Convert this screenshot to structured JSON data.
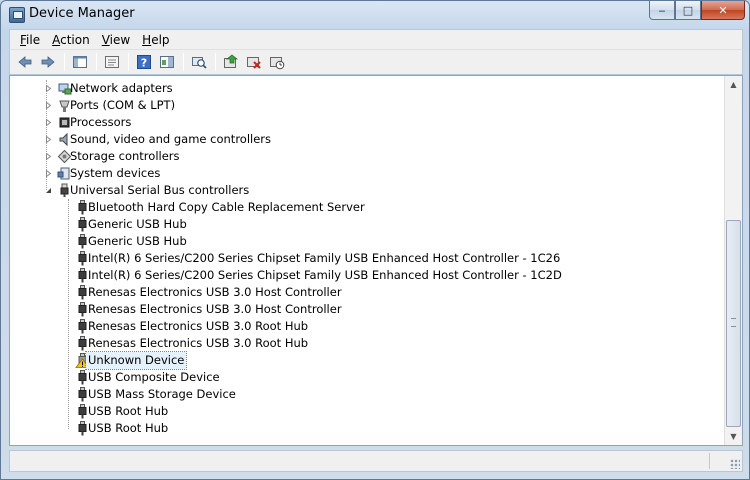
{
  "window": {
    "title": "Device Manager",
    "icon": "device-manager-icon",
    "caption_buttons": {
      "minimize": "‒",
      "maximize": "□",
      "close": "✕"
    }
  },
  "menu": {
    "items": [
      {
        "label": "File",
        "accel": "F",
        "rest": "ile"
      },
      {
        "label": "Action",
        "accel": "A",
        "rest": "ction"
      },
      {
        "label": "View",
        "accel": "V",
        "rest": "iew"
      },
      {
        "label": "Help",
        "accel": "H",
        "rest": "elp"
      }
    ]
  },
  "toolbar": {
    "buttons": [
      "back-icon",
      "forward-icon",
      "show-hide-console-tree-icon",
      "properties-icon",
      "help-icon",
      "action-pane-icon",
      "scan-hardware-icon",
      "update-driver-icon",
      "uninstall-icon",
      "disable-icon"
    ]
  },
  "tree": {
    "categories": [
      {
        "label": "Network adapters",
        "icon": "network-adapter-icon",
        "expanded": false
      },
      {
        "label": "Ports (COM & LPT)",
        "icon": "port-icon",
        "expanded": false
      },
      {
        "label": "Processors",
        "icon": "processor-icon",
        "expanded": false
      },
      {
        "label": "Sound, video and game controllers",
        "icon": "speaker-icon",
        "expanded": false
      },
      {
        "label": "Storage controllers",
        "icon": "storage-controller-icon",
        "expanded": false
      },
      {
        "label": "System devices",
        "icon": "system-device-icon",
        "expanded": false
      },
      {
        "label": "Universal Serial Bus controllers",
        "icon": "usb-icon",
        "expanded": true
      }
    ],
    "usb_children": [
      {
        "label": "Bluetooth Hard Copy Cable Replacement Server",
        "warning": false
      },
      {
        "label": "Generic USB Hub",
        "warning": false
      },
      {
        "label": "Generic USB Hub",
        "warning": false
      },
      {
        "label": "Intel(R) 6 Series/C200 Series Chipset Family USB Enhanced Host Controller - 1C26",
        "warning": false
      },
      {
        "label": "Intel(R) 6 Series/C200 Series Chipset Family USB Enhanced Host Controller - 1C2D",
        "warning": false
      },
      {
        "label": "Renesas Electronics USB 3.0 Host Controller",
        "warning": false
      },
      {
        "label": "Renesas Electronics USB 3.0 Host Controller",
        "warning": false
      },
      {
        "label": "Renesas Electronics USB 3.0 Root Hub",
        "warning": false
      },
      {
        "label": "Renesas Electronics USB 3.0 Root Hub",
        "warning": false
      },
      {
        "label": "Unknown Device",
        "warning": true,
        "selected": true
      },
      {
        "label": "USB Composite Device",
        "warning": false
      },
      {
        "label": "USB Mass Storage Device",
        "warning": false
      },
      {
        "label": "USB Root Hub",
        "warning": false
      },
      {
        "label": "USB Root Hub",
        "warning": false
      }
    ]
  },
  "colors": {
    "frame": "#c8d8ea",
    "selection": "#e5f1fb",
    "warning": "#f2c811"
  }
}
